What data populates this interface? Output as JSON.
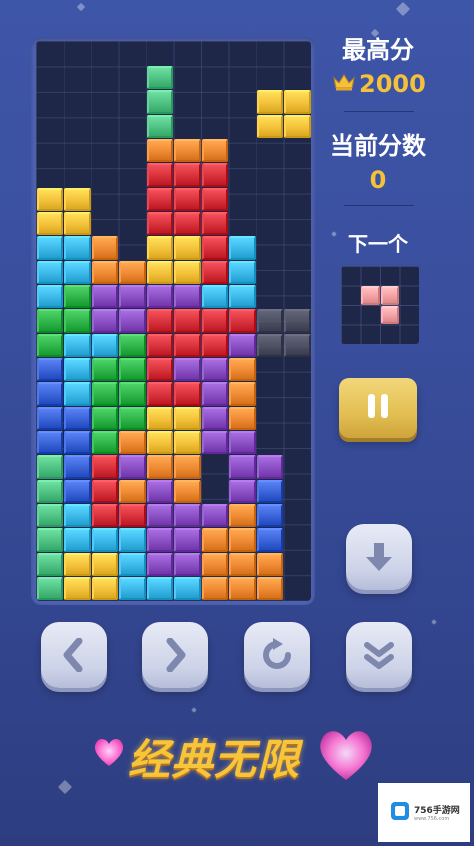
{
  "colors": {
    "red": "#d7313b",
    "orange": "#ee8a33",
    "yellow": "#f3c13a",
    "green": "#2fb44a",
    "cyan": "#3bb8e8",
    "blue": "#3a63d8",
    "purple": "#8a4fc2",
    "pink": "#f4a1a3",
    "mint": "#4fc283",
    "ghost": "#5a5d6a",
    "gold_text": "#f3c13a"
  },
  "score_panel": {
    "high_score_label": "最高分",
    "high_score_value": "2000",
    "current_score_label": "当前分数",
    "current_score_value": "0",
    "next_label": "下一个"
  },
  "next_piece": {
    "color": "pink",
    "cells": [
      [
        1,
        1
      ],
      [
        1,
        2
      ],
      [
        2,
        2
      ]
    ]
  },
  "board": {
    "cols": 10,
    "rows": 22,
    "falling_piece": {
      "color": "mint",
      "cells": [
        [
          1,
          4
        ],
        [
          2,
          4
        ],
        [
          3,
          4
        ]
      ]
    },
    "ghost_piece": {
      "color": "ghost",
      "cells": [
        [
          11,
          8
        ],
        [
          11,
          9
        ],
        [
          12,
          8
        ],
        [
          12,
          9
        ]
      ]
    },
    "stack": [
      "..........",
      "..........",
      "..........",
      "....O.....",
      "....OOO...",
      "....RRR...",
      "YY..RRR...",
      "YY..RRR...",
      "CCO.YYRC..",
      "CCOOYYRC..",
      "CGPPPPCC..",
      "GGPPRRRR..",
      "GCCGRRRP..",
      "BCGGRPPO..",
      "BCGGRRPO..",
      "BBGGYYPO..",
      "BBGOYYPP..",
      "MBRPOO.PP.",
      "MBROPO.PB.",
      "MCRRPPPOB.",
      "MCCCPPOOB.",
      "MYYCPPOOO.",
      "MYYCCCOOO."
    ]
  },
  "falling_top_piece": {
    "color": "yellow",
    "cells": [
      [
        2,
        8
      ],
      [
        2,
        9
      ],
      [
        3,
        8
      ],
      [
        3,
        9
      ]
    ]
  },
  "controls": {
    "left": "chevron-left-icon",
    "right": "chevron-right-icon",
    "rotate": "rotate-icon",
    "hard_drop": "double-chevron-down-icon",
    "soft_drop": "arrow-down-icon",
    "pause": "pause-icon"
  },
  "banner": {
    "text": "经典无限"
  },
  "watermark": {
    "text": "756手游网",
    "subtext": "www.756.com"
  }
}
